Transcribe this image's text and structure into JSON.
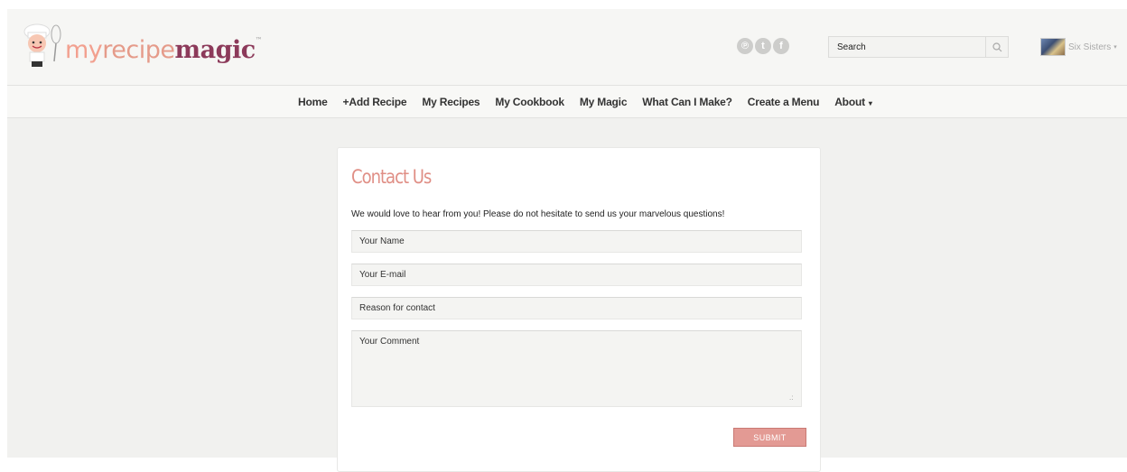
{
  "brand": {
    "logo_parts": {
      "my": "my",
      "recipe": "recipe",
      "magic": "magic",
      "tm": "™"
    }
  },
  "header": {
    "social": [
      {
        "icon": "pinterest-icon",
        "glyph": "℗"
      },
      {
        "icon": "twitter-icon",
        "glyph": "t"
      },
      {
        "icon": "facebook-icon",
        "glyph": "f"
      }
    ],
    "search": {
      "placeholder": "Search",
      "icon": "search-icon"
    },
    "user": {
      "name": "Six Sisters",
      "caret": "▾"
    }
  },
  "nav": {
    "items": [
      "Home",
      "+Add Recipe",
      "My Recipes",
      "My Cookbook",
      "My Magic",
      "What Can I Make?",
      "Create a Menu",
      "About"
    ],
    "about_caret": "▾"
  },
  "contact": {
    "title": "Contact Us",
    "intro": "We would love to hear from you! Please do not hesitate to send us your marvelous questions!",
    "fields": {
      "name_placeholder": "Your Name",
      "email_placeholder": "Your E-mail",
      "reason_placeholder": "Reason for contact",
      "comment_placeholder": "Your Comment"
    },
    "submit_label": "SUBMIT"
  },
  "colors": {
    "accent": "#e08f86",
    "submit": "#e39a94",
    "magic": "#8c3a5a",
    "page_bg": "#f1f1ef"
  }
}
